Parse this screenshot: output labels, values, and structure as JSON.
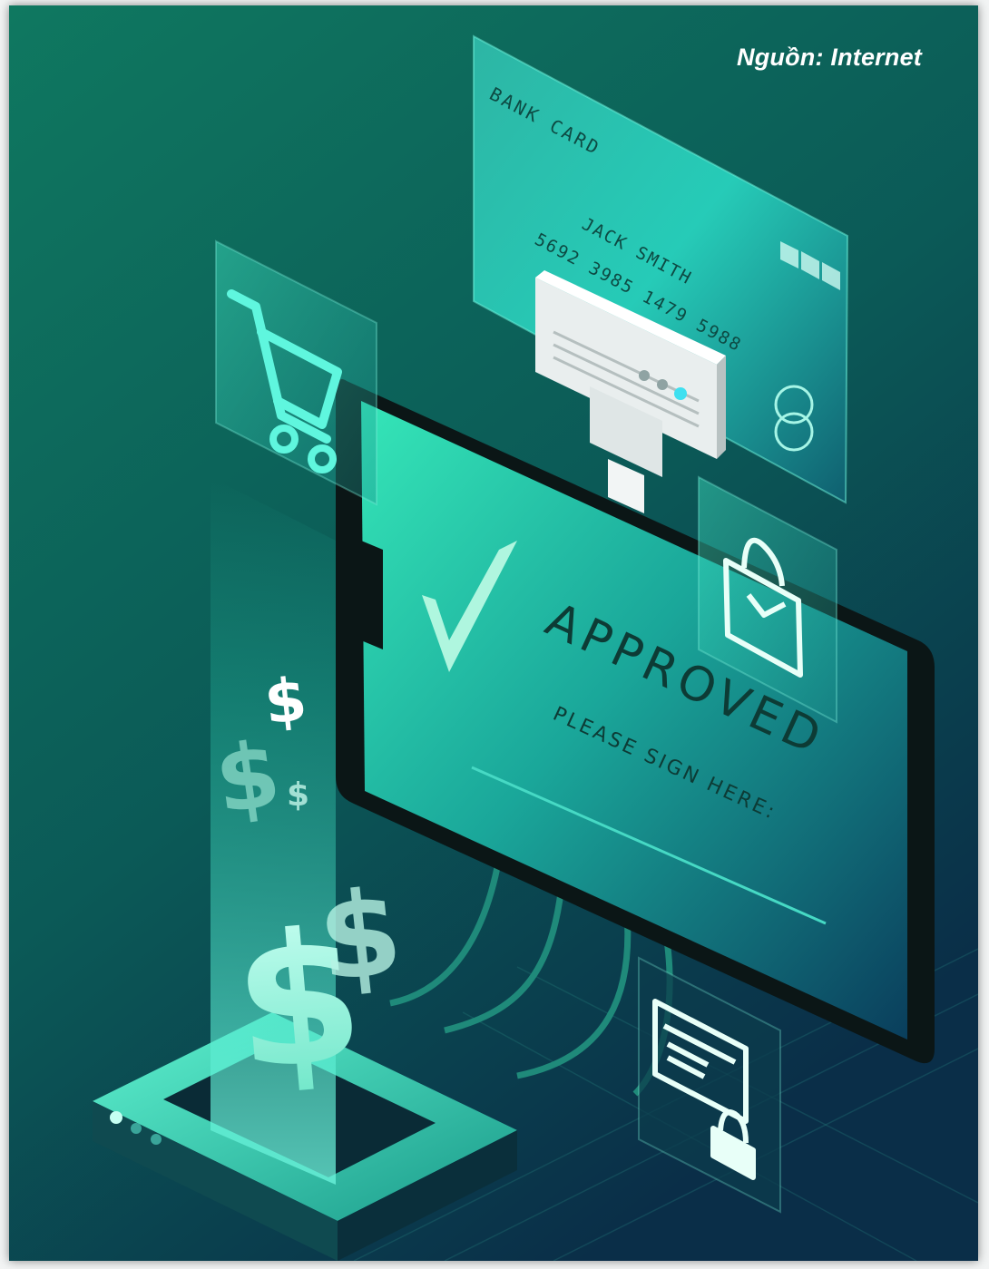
{
  "image": {
    "source_caption": "Nguồn: Internet",
    "card": {
      "title": "BANK CARD",
      "holder": "JACK SMITH",
      "number": "5692 3985 1479 5988"
    },
    "screen": {
      "status": "APPROVED",
      "instruction": "PLEASE SIGN HERE:"
    },
    "currency_symbol": "$"
  },
  "colors": {
    "bg_top": "#0f6f58",
    "bg_bottom": "#0b2f4a",
    "accent": "#4ff0d2"
  },
  "icons": [
    "shopping-cart-icon",
    "shopping-bag-check-icon",
    "secure-document-lock-icon",
    "checkmark-icon"
  ]
}
